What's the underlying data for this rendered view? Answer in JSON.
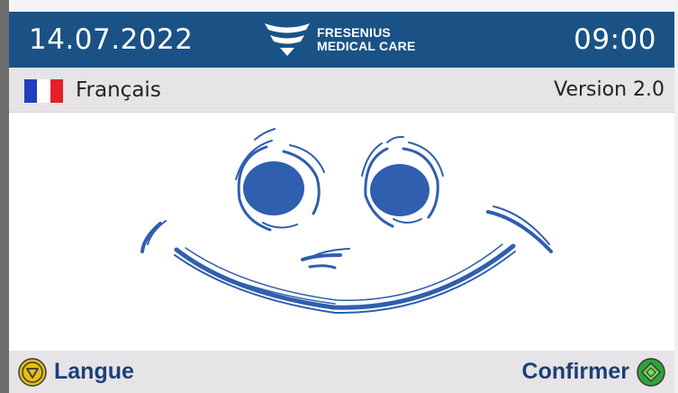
{
  "header": {
    "date": "14.07.2022",
    "time": "09:00",
    "logo": {
      "line1": "FRESENIUS",
      "line2": "MEDICAL CARE"
    },
    "background_color": "#1a5286"
  },
  "info_bar": {
    "language": "Français",
    "flag_icon": "france-flag",
    "version": "Version 2.0"
  },
  "main": {
    "illustration": "smiley-face",
    "color": "#2f5fae"
  },
  "footer": {
    "left_button": {
      "label": "Langue",
      "icon": "down-triangle-circle-icon",
      "icon_color": "#e6bf12"
    },
    "right_button": {
      "label": "Confirmer",
      "icon": "confirm-diamond-icon",
      "icon_color": "#2ea33a"
    }
  }
}
